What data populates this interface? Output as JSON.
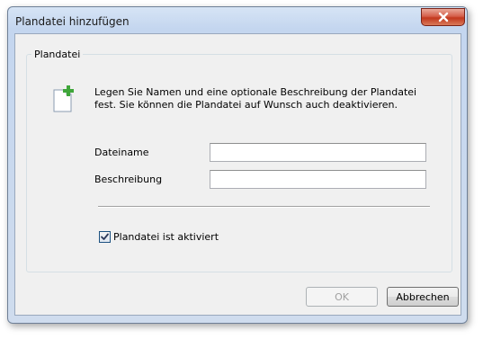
{
  "window": {
    "title": "Plandatei hinzufügen",
    "close_icon": "close-icon"
  },
  "group": {
    "legend": "Plandatei",
    "icon": "document-add-icon",
    "description": "Legen Sie Namen und eine optionale Beschreibung der Plandatei fest. Sie können die Plandatei auf Wunsch auch deaktivieren."
  },
  "fields": {
    "filename_label": "Dateiname",
    "filename_value": "",
    "description_label": "Beschreibung",
    "description_value": ""
  },
  "checkbox": {
    "label": "Plandatei ist aktiviert",
    "checked": true
  },
  "buttons": {
    "ok_label": "OK",
    "ok_enabled": false,
    "cancel_label": "Abbrechen"
  },
  "colors": {
    "close_button": "#c2381e",
    "accent_plus": "#3fa63a"
  }
}
